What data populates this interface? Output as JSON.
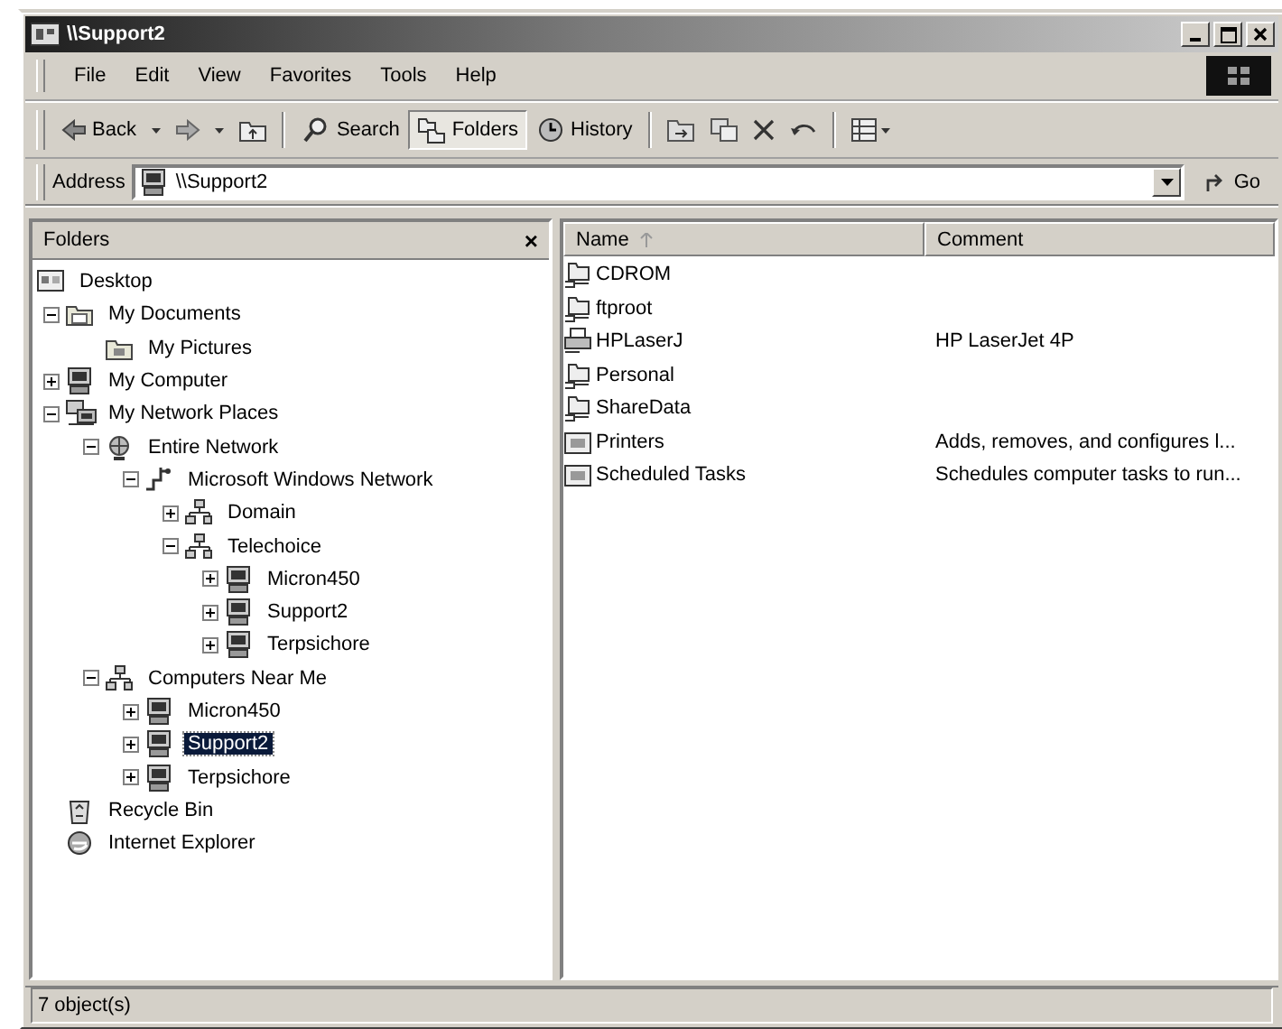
{
  "window": {
    "title": "\\\\Support2"
  },
  "menu": [
    {
      "label": "File"
    },
    {
      "label": "Edit"
    },
    {
      "label": "View"
    },
    {
      "label": "Favorites"
    },
    {
      "label": "Tools"
    },
    {
      "label": "Help"
    }
  ],
  "toolbar": {
    "back": {
      "label": "Back"
    },
    "buttons": [
      {
        "label": "Search",
        "pressed": false
      },
      {
        "label": "Folders",
        "pressed": true
      },
      {
        "label": "History",
        "pressed": false
      }
    ]
  },
  "address_bar": {
    "label": "Address",
    "value": "\\\\Support2",
    "go": "Go"
  },
  "folders_pane": {
    "title": "Folders",
    "close": "×",
    "tree": [
      {
        "label": "Desktop",
        "kind": "desktop",
        "selected": false,
        "children": [
          {
            "label": "My Documents",
            "kind": "documents",
            "expanded": true,
            "selected": false,
            "children": [
              {
                "label": "My Pictures",
                "kind": "pictures",
                "selected": false
              }
            ]
          },
          {
            "label": "My Computer",
            "kind": "computer",
            "expanded": false,
            "selected": false
          },
          {
            "label": "My Network Places",
            "kind": "network-places",
            "expanded": true,
            "selected": false,
            "children": [
              {
                "label": "Entire Network",
                "kind": "globe",
                "expanded": true,
                "selected": false,
                "children": [
                  {
                    "label": "Microsoft Windows Network",
                    "kind": "network",
                    "expanded": true,
                    "selected": false,
                    "children": [
                      {
                        "label": "Domain",
                        "kind": "workgroup",
                        "expanded": false,
                        "selected": false
                      },
                      {
                        "label": "Telechoice",
                        "kind": "workgroup",
                        "expanded": true,
                        "selected": false,
                        "children": [
                          {
                            "label": "Micron450",
                            "kind": "computer",
                            "expanded": false,
                            "selected": false
                          },
                          {
                            "label": "Support2",
                            "kind": "computer",
                            "expanded": false,
                            "selected": false
                          },
                          {
                            "label": "Terpsichore",
                            "kind": "computer",
                            "expanded": false,
                            "selected": false
                          }
                        ]
                      }
                    ]
                  }
                ]
              },
              {
                "label": "Computers Near Me",
                "kind": "workgroup",
                "expanded": true,
                "selected": false,
                "children": [
                  {
                    "label": "Micron450",
                    "kind": "computer",
                    "expanded": false,
                    "selected": false
                  },
                  {
                    "label": "Support2",
                    "kind": "computer",
                    "expanded": false,
                    "selected": true
                  },
                  {
                    "label": "Terpsichore",
                    "kind": "computer",
                    "expanded": false,
                    "selected": false
                  }
                ]
              }
            ]
          },
          {
            "label": "Recycle Bin",
            "kind": "recycle-bin",
            "selected": false
          },
          {
            "label": "Internet Explorer",
            "kind": "browser",
            "selected": false
          }
        ]
      }
    ]
  },
  "file_list": {
    "columns": [
      {
        "label": "Name",
        "sorted": true
      },
      {
        "label": "Comment",
        "sorted": false
      }
    ],
    "rows": [
      {
        "name": "CDROM",
        "comment": "",
        "kind": "share"
      },
      {
        "name": "ftproot",
        "comment": "",
        "kind": "share"
      },
      {
        "name": "HPLaserJ",
        "comment": "HP LaserJet 4P",
        "kind": "printer"
      },
      {
        "name": "Personal",
        "comment": "",
        "kind": "share"
      },
      {
        "name": "ShareData",
        "comment": "",
        "kind": "share"
      },
      {
        "name": "Printers",
        "comment": "Adds, removes, and configures l...",
        "kind": "system-folder"
      },
      {
        "name": "Scheduled Tasks",
        "comment": "Schedules computer tasks to run...",
        "kind": "system-folder"
      }
    ]
  },
  "status_bar": {
    "text": "7 object(s)"
  }
}
